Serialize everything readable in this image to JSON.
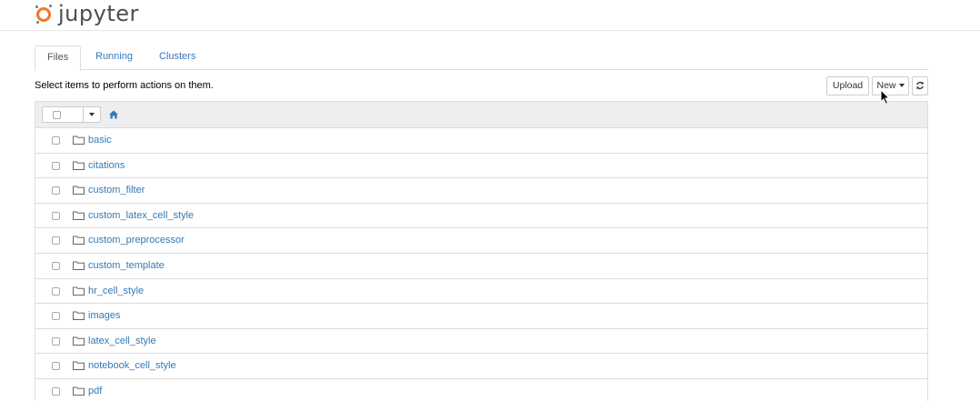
{
  "app": {
    "logo_text": "jupyter"
  },
  "tabs": [
    {
      "label": "Files"
    },
    {
      "label": "Running"
    },
    {
      "label": "Clusters"
    }
  ],
  "toolbar": {
    "instructions": "Select items to perform actions on them.",
    "upload_label": "Upload",
    "new_label": "New",
    "refresh_icon": "refresh-icon"
  },
  "files": [
    {
      "name": "basic",
      "type": "folder"
    },
    {
      "name": "citations",
      "type": "folder"
    },
    {
      "name": "custom_filter",
      "type": "folder"
    },
    {
      "name": "custom_latex_cell_style",
      "type": "folder"
    },
    {
      "name": "custom_preprocessor",
      "type": "folder"
    },
    {
      "name": "custom_template",
      "type": "folder"
    },
    {
      "name": "hr_cell_style",
      "type": "folder"
    },
    {
      "name": "images",
      "type": "folder"
    },
    {
      "name": "latex_cell_style",
      "type": "folder"
    },
    {
      "name": "notebook_cell_style",
      "type": "folder"
    },
    {
      "name": "pdf",
      "type": "folder"
    }
  ],
  "colors": {
    "brand": "#f37726",
    "link": "#337ab7"
  }
}
